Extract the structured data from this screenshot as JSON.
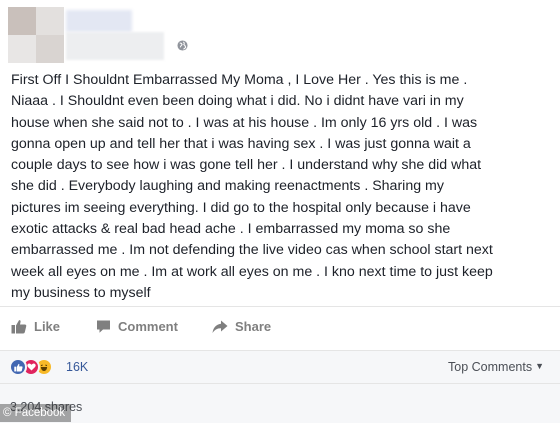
{
  "post": {
    "text": "First Off I Shouldnt Embarrassed My Moma , I Love Her . Yes this is me .\nNiaaa . I Shouldnt even been doing what i did. No i didnt have vari in my\nhouse when she said not to . I was at his house . Im only 16 yrs old . I was\ngonna open up and tell her that i was having sex . I was just gonna wait a\ncouple days to see how i was gone tell her . I understand why she did what\nshe did . Everybody laughing and making reenactments . Sharing my\npictures im seeing everything. I did go to the hospital only because i have\nexotic attacks & real bad head ache . I embarrassed my moma so she\nembarrassed me . Im not defending the live video cas when school start next\nweek all eyes on me . Im at work all eyes on me . I kno next time to just keep\nmy business to myself"
  },
  "actions": {
    "like_label": "Like",
    "comment_label": "Comment",
    "share_label": "Share"
  },
  "reactions": {
    "icons": [
      "like-icon",
      "love-icon",
      "haha-icon"
    ],
    "count": "16K"
  },
  "comments": {
    "sort_label": "Top Comments"
  },
  "shares": {
    "label": "3,204 shares"
  },
  "watermark": {
    "text": "© Facebook"
  },
  "colors": {
    "link_blue": "#365899",
    "like_blue": "#4267b2",
    "love_red": "#e0245e",
    "haha_yellow": "#f7b928",
    "action_gray": "#7f7f7f"
  }
}
